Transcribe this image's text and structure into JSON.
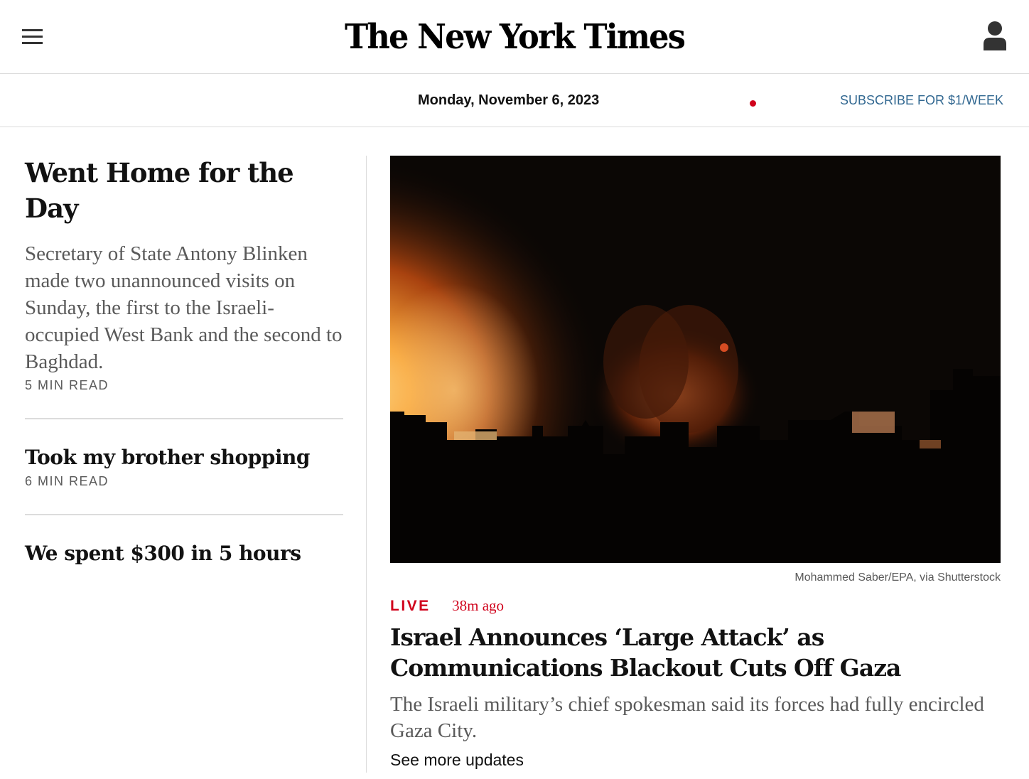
{
  "masthead": {
    "menu_icon": "hamburger-menu-icon",
    "logo_text": "The New York Times",
    "account_icon": "account-icon"
  },
  "datebar": {
    "date": "Monday, November 6, 2023",
    "subscribe_label": "SUBSCRIBE FOR $1/WEEK",
    "subscribe_color": "#326891",
    "live_dot_color": "#d0021b"
  },
  "left_column": {
    "stories": [
      {
        "title": "Went Home for the Day",
        "summary": "Secretary of State Antony Blinken made two unannounced visits on Sunday, the first to the Israeli-occupied West Bank and the second to Baghdad.",
        "read_time": "5 MIN READ"
      },
      {
        "title": "Took my brother shopping",
        "read_time": "6 MIN READ"
      },
      {
        "title": "We spent $300 in 5 hours"
      }
    ]
  },
  "lead_story": {
    "image_credit": "Mohammed Saber/EPA, via Shutterstock",
    "live_label": "LIVE",
    "time_ago": "38m ago",
    "headline": "Israel Announces ‘Large Attack’ as Communications Blackout Cuts Off Gaza",
    "summary": "The Israeli military’s chief spokesman said its forces had fully encircled Gaza City.",
    "see_more_label": "See more updates",
    "accent_color": "#d0021b"
  }
}
